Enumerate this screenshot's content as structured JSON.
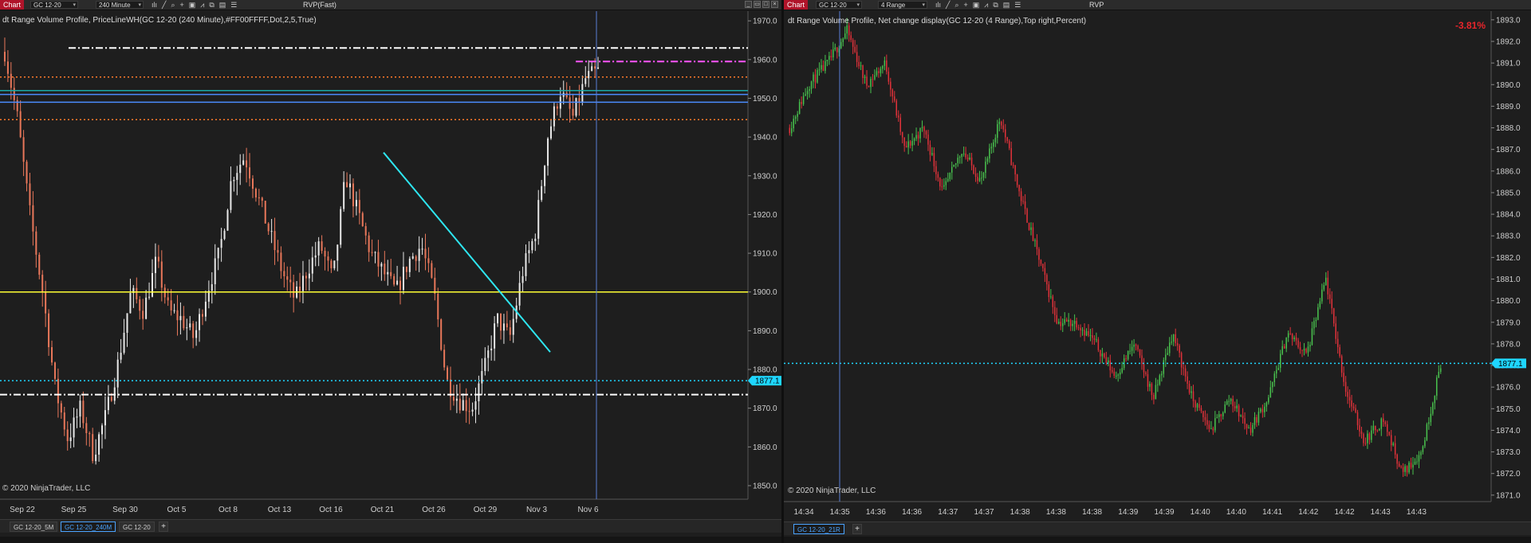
{
  "left": {
    "chart_tag": "Chart",
    "instrument": "GC 12-20",
    "interval": "240 Minute",
    "indicator_button": "RVP(Fast)",
    "indicator_label": "dt Range Volume Profile, PriceLineWH(GC 12-20 (240 Minute),#FF00FFFF,Dot,2,5,True)",
    "copyright": "© 2020 NinjaTrader, LLC",
    "price_marker": "1877.1",
    "tabs": [
      "GC 12-20_5M",
      "GC 12-20_240M",
      "GC 12-20"
    ],
    "active_tab": 1,
    "icons": [
      "bar-style-icon",
      "draw-tool-icon",
      "zoom-icon",
      "crosshair-icon",
      "data-box-icon",
      "indicators-icon",
      "strategies-icon",
      "templates-icon",
      "properties-icon"
    ]
  },
  "right": {
    "chart_tag": "Chart",
    "instrument": "GC 12-20",
    "interval": "4 Range",
    "indicator_button": "RVP",
    "indicator_label": "dt Range Volume Profile, Net change display(GC 12-20 (4 Range),Top right,Percent)",
    "copyright": "© 2020 NinjaTrader, LLC",
    "net_change": "-3.81%",
    "price_marker": "1877.1",
    "tabs": [
      "GC 12-20_21R"
    ],
    "icons": [
      "bar-style-icon",
      "draw-tool-icon",
      "zoom-icon",
      "crosshair-icon",
      "data-box-icon",
      "indicators-icon",
      "strategies-icon",
      "templates-icon",
      "properties-icon"
    ]
  },
  "chart_data": [
    {
      "type": "candlestick",
      "title": "GC 12-20 (240 Minute)",
      "x_labels": [
        "Sep 22",
        "Sep 25",
        "Sep 30",
        "Oct 5",
        "Oct 8",
        "Oct 13",
        "Oct 16",
        "Oct 21",
        "Oct 26",
        "Oct 29",
        "Nov 3",
        "Nov 6"
      ],
      "y_ticks": [
        1850.0,
        1860.0,
        1870.0,
        1880.0,
        1890.0,
        1900.0,
        1910.0,
        1920.0,
        1930.0,
        1940.0,
        1950.0,
        1960.0,
        1970.0
      ],
      "ylim": [
        1846.5,
        1972.5
      ],
      "close_path": [
        1962,
        1945,
        1920,
        1900,
        1875,
        1862,
        1870,
        1858,
        1868,
        1882,
        1900,
        1895,
        1908,
        1895,
        1893,
        1888,
        1900,
        1910,
        1930,
        1935,
        1925,
        1915,
        1905,
        1898,
        1906,
        1912,
        1903,
        1930,
        1920,
        1910,
        1905,
        1900,
        1908,
        1912,
        1900,
        1877,
        1872,
        1870,
        1880,
        1893,
        1888,
        1905,
        1915,
        1940,
        1952,
        1945,
        1955,
        1957
      ],
      "horizontal_lines": [
        {
          "price": 1963.0,
          "color": "#ffffff",
          "style": "dash-dot"
        },
        {
          "price": 1959.5,
          "color": "#ff55ff",
          "style": "dash-dot"
        },
        {
          "price": 1955.5,
          "color": "#ff7a2a",
          "style": "dotted"
        },
        {
          "price": 1952.0,
          "color": "#1aaaa8",
          "style": "solid"
        },
        {
          "price": 1951.0,
          "color": "#4b8cff",
          "style": "solid"
        },
        {
          "price": 1949.0,
          "color": "#4b8cff",
          "style": "solid"
        },
        {
          "price": 1944.5,
          "color": "#ff7a2a",
          "style": "dotted"
        },
        {
          "price": 1900.0,
          "color": "#ffff33",
          "style": "solid"
        },
        {
          "price": 1877.1,
          "color": "#1fd6ff",
          "style": "dotted"
        },
        {
          "price": 1873.5,
          "color": "#ffffff",
          "style": "dash-dot"
        }
      ],
      "trend_line": {
        "color": "#2ee6f0",
        "from_price": 1936.0,
        "to_price": 1884.5
      }
    },
    {
      "type": "candlestick",
      "title": "GC 12-20 (4 Range)",
      "x_labels": [
        "14:34",
        "14:35",
        "14:36",
        "14:36",
        "14:37",
        "14:37",
        "14:38",
        "14:38",
        "14:38",
        "14:39",
        "14:39",
        "14:40",
        "14:40",
        "14:41",
        "14:42",
        "14:42",
        "14:43",
        "14:43"
      ],
      "y_ticks": [
        1871.0,
        1872.0,
        1873.0,
        1874.0,
        1875.0,
        1876.0,
        1877.0,
        1878.0,
        1879.0,
        1880.0,
        1881.0,
        1882.0,
        1883.0,
        1884.0,
        1885.0,
        1886.0,
        1887.0,
        1888.0,
        1889.0,
        1890.0,
        1891.0,
        1892.0,
        1893.0
      ],
      "ylim": [
        1870.7,
        1893.4
      ],
      "close_path": [
        1888,
        1890,
        1891,
        1892.5,
        1890,
        1891,
        1887,
        1888,
        1885,
        1887,
        1885.5,
        1888.5,
        1885,
        1882,
        1879,
        1879,
        1878,
        1876.5,
        1878,
        1875.5,
        1878.5,
        1875.5,
        1874,
        1875.5,
        1874,
        1875.5,
        1878.5,
        1877.5,
        1881,
        1876,
        1873.5,
        1874.5,
        1872,
        1873,
        1877.1
      ],
      "horizontal_lines": [
        {
          "price": 1877.1,
          "color": "#1fd6ff",
          "style": "dotted"
        }
      ]
    }
  ]
}
